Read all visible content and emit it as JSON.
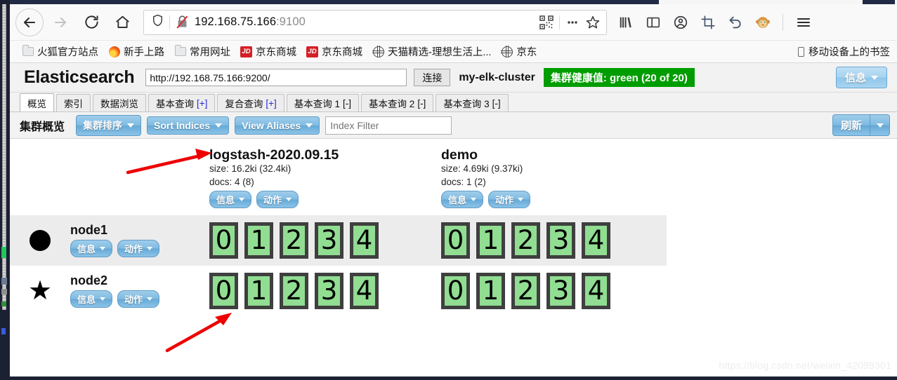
{
  "browser": {
    "nav": {
      "back": "back-arrow",
      "forward": "forward-arrow",
      "reload": "reload",
      "home": "home"
    },
    "url": {
      "host": "192.168.75.166",
      "port": ":9100",
      "shield_icon": "shield-icon",
      "broken_lock_icon": "broken-lock-icon",
      "qr_icon": "qr-code-icon",
      "more_icon": "ellipsis-icon",
      "bookmark_icon": "star-icon"
    },
    "toolbar_icons": [
      {
        "name": "library-icon",
        "glyph": "library"
      },
      {
        "name": "sidebar-icon",
        "glyph": "sidebar"
      },
      {
        "name": "account-icon",
        "glyph": "account"
      },
      {
        "name": "screenshot-icon",
        "glyph": "crop"
      },
      {
        "name": "undo-icon",
        "glyph": "undo"
      },
      {
        "name": "monkey-extension-icon",
        "glyph": "monkey"
      },
      {
        "name": "menu-icon",
        "glyph": "hamburger"
      }
    ],
    "bookmarks": [
      {
        "label": "火狐官方站点",
        "icon": "folder"
      },
      {
        "label": "新手上路",
        "icon": "firefox"
      },
      {
        "label": "常用网址",
        "icon": "folder"
      },
      {
        "label": "京东商城",
        "icon": "jd"
      },
      {
        "label": "京东商城",
        "icon": "jd"
      },
      {
        "label": "天猫精选-理想生活上...",
        "icon": "globe"
      },
      {
        "label": "京东",
        "icon": "globe"
      }
    ],
    "bookmarks_right": {
      "label": "移动设备上的书签",
      "icon": "phone"
    }
  },
  "app": {
    "title": "Elasticsearch",
    "connect_url": "http://192.168.75.166:9200/",
    "connect_url_placeholder": "http://localhost:9200/",
    "connect_button": "连接",
    "cluster_name": "my-elk-cluster",
    "health": {
      "text": "集群健康值: green (20 of 20)",
      "color": "#009d00"
    },
    "info_button": "信息",
    "tabs": [
      {
        "label": "概览",
        "active": true
      },
      {
        "label": "索引",
        "active": false
      },
      {
        "label": "数据浏览",
        "active": false
      },
      {
        "label": "基本查询",
        "suffix": "[+]",
        "suffix_type": "plus",
        "active": false
      },
      {
        "label": "复合查询",
        "suffix": "[+]",
        "suffix_type": "plus",
        "active": false
      },
      {
        "label": "基本查询 1",
        "suffix": "[-]",
        "suffix_type": "minus",
        "active": false
      },
      {
        "label": "基本查询 2",
        "suffix": "[-]",
        "suffix_type": "minus",
        "active": false
      },
      {
        "label": "基本查询 3",
        "suffix": "[-]",
        "suffix_type": "minus",
        "active": false
      }
    ],
    "subbar": {
      "title": "集群概览",
      "sort_cluster": "集群排序",
      "sort_indices": "Sort Indices",
      "view_aliases": "View Aliases",
      "index_filter_placeholder": "Index Filter",
      "refresh": "刷新"
    },
    "indices": [
      {
        "name": "logstash-2020.09.15",
        "size": "size: 16.2ki (32.4ki)",
        "docs": "docs: 4 (8)",
        "info_label": "信息",
        "action_label": "动作"
      },
      {
        "name": "demo",
        "size": "size: 4.69ki (9.37ki)",
        "docs": "docs: 1 (2)",
        "info_label": "信息",
        "action_label": "动作"
      }
    ],
    "nodes": [
      {
        "name": "node1",
        "marker": "circle",
        "info_label": "信息",
        "action_label": "动作",
        "shards": [
          [
            "0",
            "1",
            "2",
            "3",
            "4"
          ],
          [
            "0",
            "1",
            "2",
            "3",
            "4"
          ]
        ]
      },
      {
        "name": "node2",
        "marker": "star",
        "info_label": "信息",
        "action_label": "动作",
        "shards": [
          [
            "0",
            "1",
            "2",
            "3",
            "4"
          ],
          [
            "0",
            "1",
            "2",
            "3",
            "4"
          ]
        ]
      }
    ]
  },
  "annotations": {
    "watermark": "https://blog.csdn.net/weixin_42099301",
    "arrows": [
      {
        "name": "arrow-to-logstash-index"
      },
      {
        "name": "arrow-to-node2-shards"
      }
    ]
  }
}
